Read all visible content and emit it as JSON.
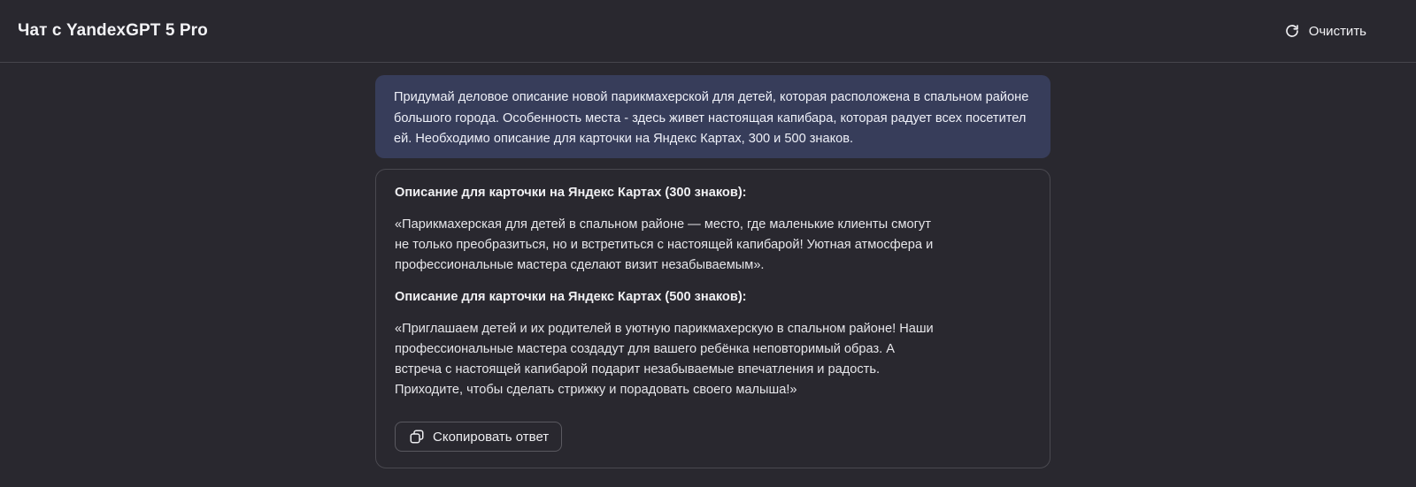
{
  "header": {
    "title": "Чат с YandexGPT 5 Pro",
    "clear_label": "Очистить",
    "clear_icon": "refresh-icon"
  },
  "chat": {
    "user_message": "Придумай деловое описание новой парикмахерской для детей, которая расположена в спальном районе большого города. Особенность места - здесь живет настоящая капибара, которая радует всех посетителей. Необходимо описание для карточки на Яндекс Картах, 300 и 500 знаков.",
    "answer": {
      "heading_300": "Описание для карточки на Яндекс Картах (300 знаков):",
      "text_300": "«Парикмахерская для детей в спальном районе — место, где маленькие клиенты смогут\nне только преобразиться, но и встретиться с настоящей капибарой! Уютная атмосфера и\nпрофессиональные мастера сделают визит незабываемым».",
      "heading_500": "Описание для карточки на Яндекс Картах (500 знаков):",
      "text_500": "«Приглашаем детей и их родителей в уютную парикмахерскую в спальном районе! Наши\nпрофессиональные мастера создадут для вашего ребёнка неповторимый образ. А\nвстреча с настоящей капибарой подарит незабываемые впечатления и радость.\nПриходите, чтобы сделать стрижку и порадовать своего малыша!»",
      "copy_label": "Скопировать ответ",
      "copy_icon": "copy-icon"
    }
  },
  "colors": {
    "background": "#29282f",
    "user_bubble": "#373d5a",
    "border": "#4a4950",
    "text": "#ececf1"
  }
}
